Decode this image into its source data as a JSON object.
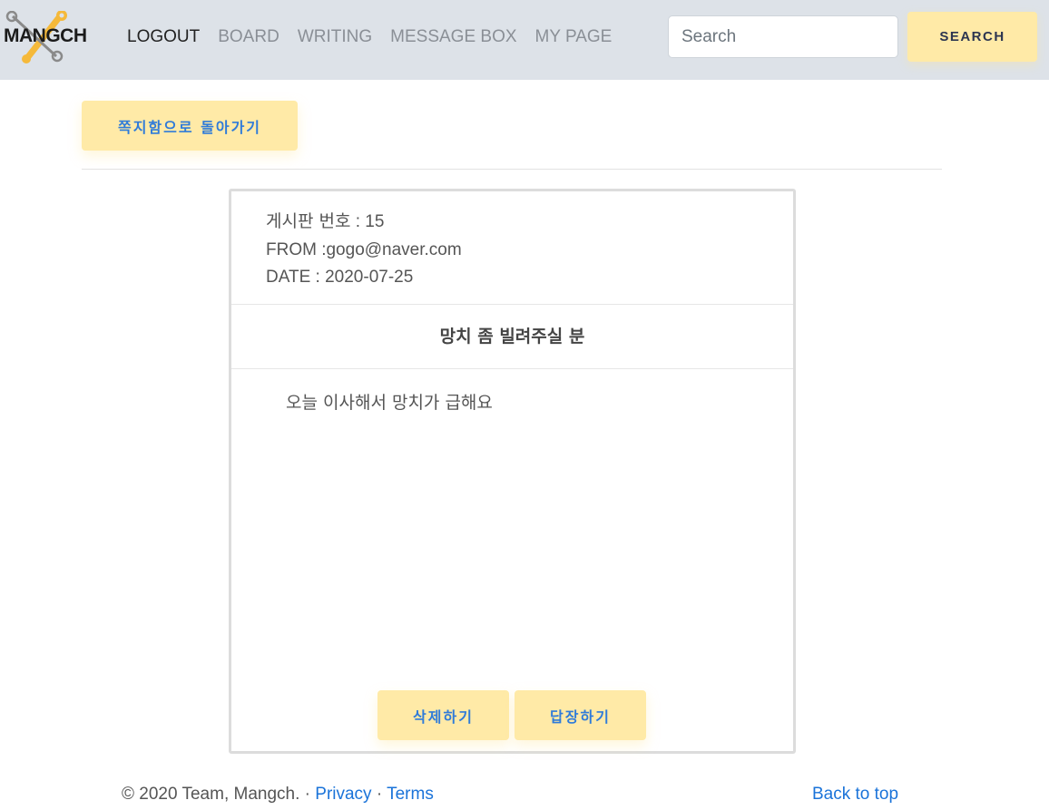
{
  "brand": {
    "logo_text": "MANGCH"
  },
  "nav": {
    "items": [
      {
        "label": "LOGOUT"
      },
      {
        "label": "BOARD"
      },
      {
        "label": "WRITING"
      },
      {
        "label": "MESSAGE BOX"
      },
      {
        "label": "MY PAGE"
      }
    ]
  },
  "search": {
    "placeholder": "Search",
    "value": "",
    "button_label": "SEARCH"
  },
  "back_button": {
    "label": "쪽지함으로 돌아가기"
  },
  "message": {
    "board_no_label": "게시판 번호",
    "board_no_value": " : 15",
    "from_text": "FROM :gogo@naver.com",
    "date_text": "DATE : 2020-07-25",
    "title": "망치 좀 빌려주실 분",
    "body": "오늘 이사해서 망치가 급해요"
  },
  "actions": {
    "delete_label": "삭제하기",
    "reply_label": "답장하기"
  },
  "footer": {
    "copyright": "© 2020 Team, Mangch. · ",
    "privacy": "Privacy",
    "sep": " · ",
    "terms": "Terms",
    "back_to_top": "Back to top"
  },
  "colors": {
    "navbar_bg": "#dde2e8",
    "button_yellow": "#ffeaa7",
    "link_blue": "#1a73d9",
    "logo_accent": "#f5b93a"
  }
}
